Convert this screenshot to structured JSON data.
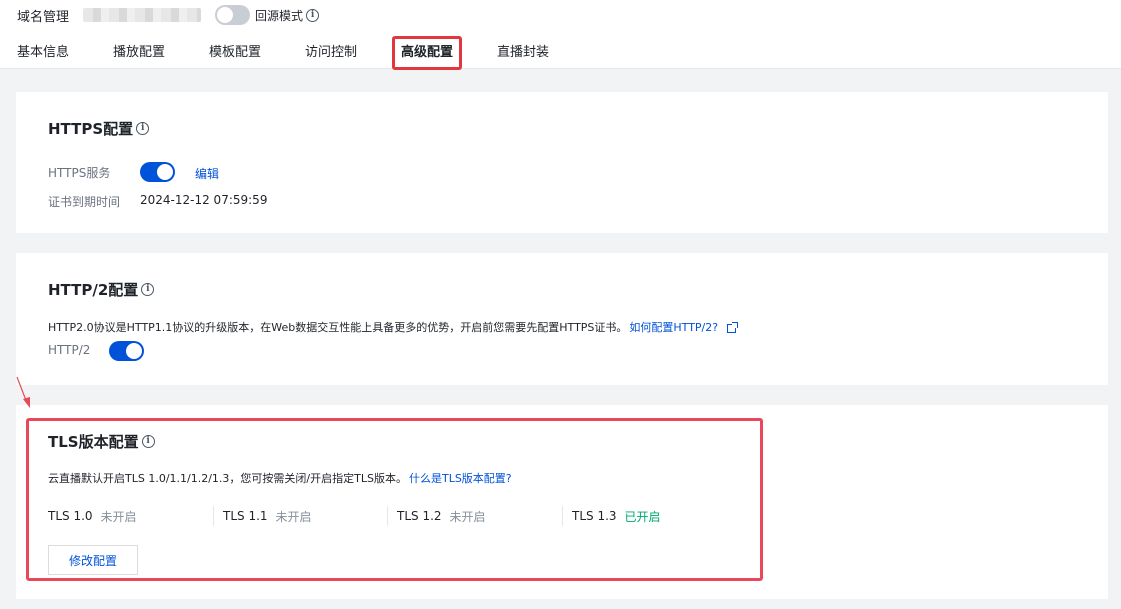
{
  "header": {
    "title": "域名管理",
    "origin_mode_label": "回源模式",
    "origin_mode_enabled": false
  },
  "tabs": [
    {
      "label": "基本信息",
      "active": false
    },
    {
      "label": "播放配置",
      "active": false
    },
    {
      "label": "模板配置",
      "active": false
    },
    {
      "label": "访问控制",
      "active": false
    },
    {
      "label": "高级配置",
      "active": true
    },
    {
      "label": "直播封装",
      "active": false
    }
  ],
  "https_card": {
    "title": "HTTPS配置",
    "service_label": "HTTPS服务",
    "service_enabled": true,
    "edit_link": "编辑",
    "cert_expiry_label": "证书到期时间",
    "cert_expiry_value": "2024-12-12 07:59:59"
  },
  "http2_card": {
    "title": "HTTP/2配置",
    "description": "HTTP2.0协议是HTTP1.1协议的升级版本，在Web数据交互性能上具备更多的优势，开启前您需要先配置HTTPS证书。",
    "help_link": "如何配置HTTP/2?",
    "toggle_label": "HTTP/2",
    "enabled": true
  },
  "tls_card": {
    "title": "TLS版本配置",
    "description": "云直播默认开启TLS 1.0/1.1/1.2/1.3，您可按需关闭/开启指定TLS版本。",
    "help_link": "什么是TLS版本配置?",
    "versions": [
      {
        "name": "TLS 1.0",
        "state": "未开启",
        "enabled": false
      },
      {
        "name": "TLS 1.1",
        "state": "未开启",
        "enabled": false
      },
      {
        "name": "TLS 1.2",
        "state": "未开启",
        "enabled": false
      },
      {
        "name": "TLS 1.3",
        "state": "已开启",
        "enabled": true
      }
    ],
    "modify_button": "修改配置"
  },
  "colors": {
    "primary": "#0052d9",
    "success": "#00a870",
    "annotation_red": "#e9485a"
  },
  "icons": [
    "info-icon",
    "external-link-icon",
    "annotation-arrow-icon"
  ]
}
